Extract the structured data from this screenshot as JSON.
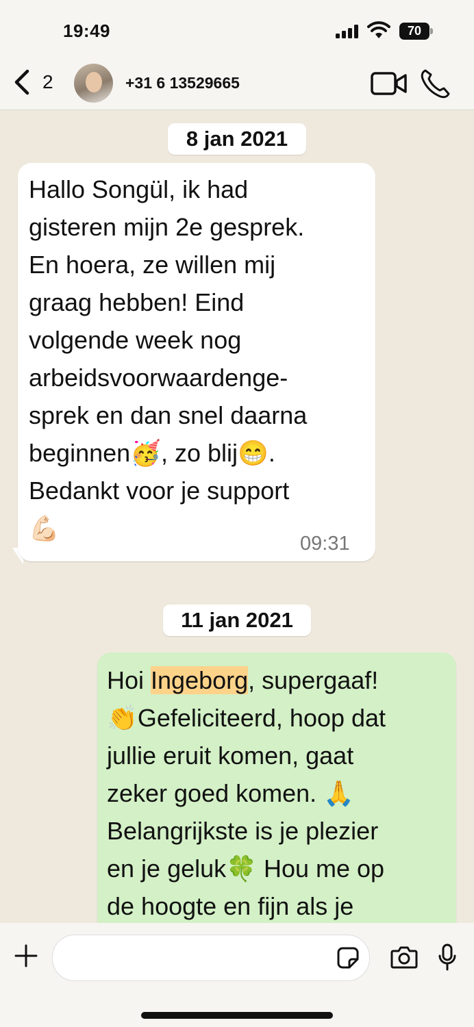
{
  "status_bar": {
    "time": "19:49",
    "battery": "70"
  },
  "header": {
    "back_count": "2",
    "contact": "+31 6 13529665"
  },
  "messages": [
    {
      "date": "8 jan 2021",
      "text": "Hallo Songül, ik had\ngisteren mijn 2e gesprek.\nEn hoera, ze willen mij\ngraag hebben! Eind\nvolgende week nog\narbeidsvoorwaardenge-\nsprek en dan snel daarna\nbeginnen🥳, zo blij😁.\nBedankt voor je support\n💪🏻",
      "time": "09:31",
      "direction": "incoming"
    },
    {
      "date": "11 jan 2021",
      "text_prefix": "Hoi ",
      "highlight": "Ingeborg",
      "text_suffix": ", supergaaf!\n👏Gefeliciteerd, hoop dat\njullie eruit komen, gaat\nzeker goed komen. 🙏\nBelangrijkste is je plezier\nen je geluk🍀 Hou me op\nde hoogte en fijn als je",
      "direction": "outgoing"
    }
  ],
  "input": {
    "placeholder": ""
  },
  "colors": {
    "incoming_bubble": "#ffffff",
    "outgoing_bubble": "#d3f0c6",
    "highlight": "#fdd38a",
    "background": "#efe9dd"
  },
  "icons": [
    "signal-icon",
    "wifi-icon",
    "battery-icon",
    "back-chevron-icon",
    "video-call-icon",
    "phone-call-icon",
    "plus-icon",
    "sticker-icon",
    "camera-icon",
    "microphone-icon"
  ]
}
